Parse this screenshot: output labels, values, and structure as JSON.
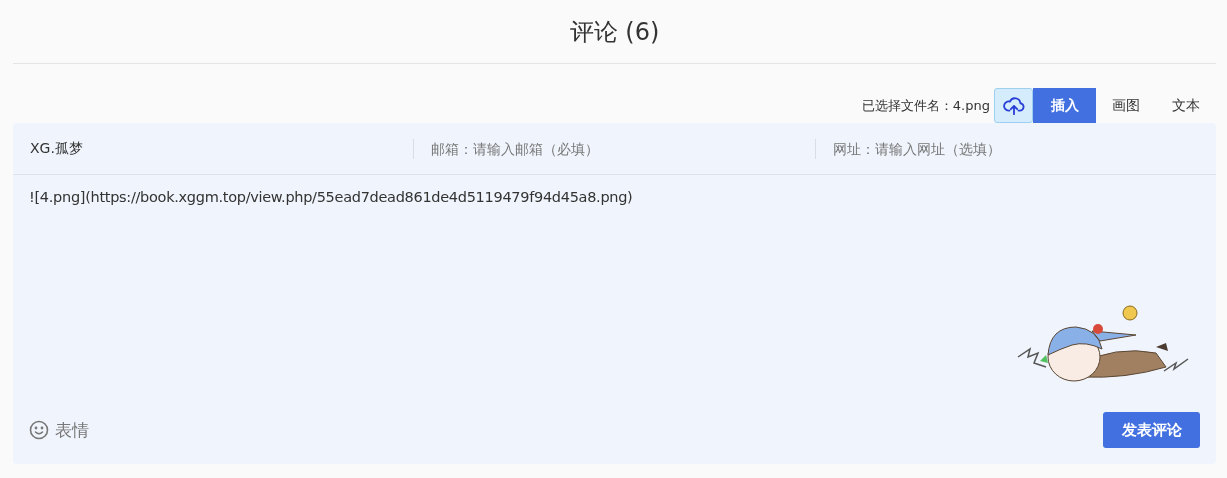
{
  "title": "评论 (6)",
  "toolbar": {
    "file_label": "已选择文件名：4.png",
    "tabs": [
      {
        "label": "插入",
        "selected": true
      },
      {
        "label": "画图",
        "selected": false
      },
      {
        "label": "文本",
        "selected": false
      }
    ]
  },
  "fields": {
    "nickname": {
      "value": "XG.孤梦"
    },
    "email": {
      "placeholder": "邮箱：请输入邮箱（必填）"
    },
    "url": {
      "placeholder": "网址：请输入网址（选填）"
    }
  },
  "content": {
    "value": "![4.png](https://book.xggm.top/view.php/55ead7dead861de4d5119479f94d45a8.png)"
  },
  "emoji_label": "表情",
  "submit_label": "发表评论"
}
